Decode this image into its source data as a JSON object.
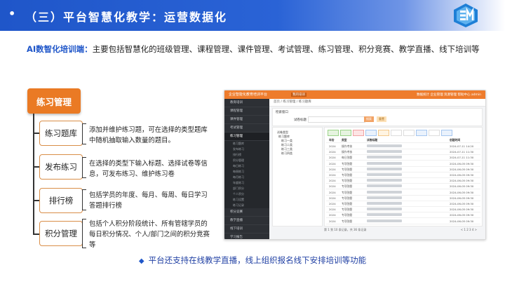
{
  "header": {
    "bullet": "•",
    "title": "（三）平台智慧化教学：运营数据化"
  },
  "intro": {
    "highlight": "AI数智化培训端：",
    "text": "主要包括智慧化的班级管理、课程管理、课件管理、考试管理、练习管理、积分竞赛、教学直播、线下培训等"
  },
  "module": {
    "title": "练习管理",
    "items": [
      {
        "label": "练习题库",
        "desc": "添加并维护练习题，可在选择的类型题库中随机抽取输入数量的题目。"
      },
      {
        "label": "发布练习",
        "desc": "在选择的类型下输入标题、选择试卷等信息，可发布练习、维护练习卷"
      },
      {
        "label": "排行榜",
        "desc": "包括学员的年度、每月、每周、每日学习答题排行榜"
      },
      {
        "label": "积分管理",
        "desc": "包括个人积分阶段统计、所有管辖学员的每日积分情况、个人/部门之间的积分竞赛等"
      }
    ]
  },
  "screenshot": {
    "app_title": "企业智能化教育培训平台",
    "active_tab": "我的培训",
    "top_right": "数据统计   企业管理   资源管理   帮助中心   admin",
    "breadcrumb": "首页  /  练习管理  /  练习题库",
    "search_title": "检索窗口",
    "search_label": "试卷标题",
    "search_btn": "搜索",
    "reset_btn": "重置",
    "tree_title": "试卷类型",
    "tree_items": [
      "练习题库",
      "练习一类",
      "练习二类",
      "练习三类",
      "练习四类"
    ],
    "sidebar": [
      "教育培训",
      "课程管理",
      "课件管理",
      "考试管理",
      "练习管理",
      "积分竞赛",
      "教学直播",
      "线下培训",
      "学习报告",
      "统计分析"
    ],
    "sidebar_sub": [
      "练习题库",
      "发布练习",
      "排行榜",
      "积分管理",
      "每日练习",
      "每周练习",
      "每月练习",
      "年度练习",
      "部门积分",
      "个人积分",
      "练习设置",
      "练习记录"
    ],
    "col_year": "年份",
    "col_type": "类型",
    "col_title": "试卷标题",
    "col_date": "创建时间",
    "rows": [
      {
        "year": "2024",
        "type": "操作考核",
        "date": "2024-07-11 14:20"
      },
      {
        "year": "2024",
        "type": "操作考核",
        "date": "2024-07-11 11:30"
      },
      {
        "year": "2024",
        "type": "每日答题",
        "date": "2024-07-11 11:30"
      },
      {
        "year": "2024",
        "type": "专项答题",
        "date": "2024-06-05 09:30"
      },
      {
        "year": "2024",
        "type": "专项答题",
        "date": "2024-06-05 09:30"
      },
      {
        "year": "2024",
        "type": "专项答题",
        "date": "2024-06-05 09:30"
      },
      {
        "year": "2024",
        "type": "专项答题",
        "date": "2024-06-05 09:30"
      },
      {
        "year": "2024",
        "type": "专项答题",
        "date": "2024-06-05 09:30"
      },
      {
        "year": "2024",
        "type": "专项答题",
        "date": "2024-06-05 09:30"
      },
      {
        "year": "2024",
        "type": "专项答题",
        "date": "2024-06-05 09:30"
      },
      {
        "year": "2024",
        "type": "专项答题",
        "date": "2024-06-05 09:30"
      },
      {
        "year": "2024",
        "type": "专项答题",
        "date": "2024-06-05 09:30"
      },
      {
        "year": "2024",
        "type": "专项答题",
        "date": "2024-06-05 09:30"
      },
      {
        "year": "2024",
        "type": "专项答题",
        "date": "2024-06-05 09:30"
      }
    ],
    "footer": "第 1 到 10 条记录，共 36 条记录",
    "pager": "< 1 2 3 4 >"
  },
  "bottom": {
    "icon": "diamond-icon",
    "text": "平台还支持在线教学直播，线上组织报名线下安排培训等功能"
  }
}
